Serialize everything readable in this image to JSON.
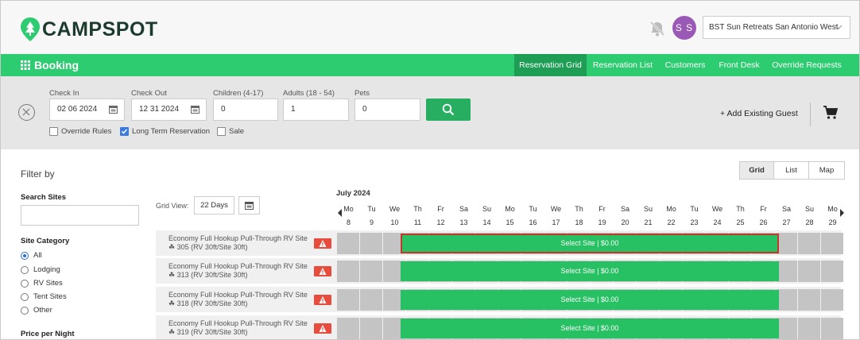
{
  "header": {
    "logo_text": "CAMPSPOT",
    "avatar_initials": "S S",
    "park_name": "BST Sun Retreats San Antonio West",
    "colors": {
      "brand": "#2ecc71",
      "avatar": "#9b59b6"
    }
  },
  "nav": {
    "title": "Booking",
    "tabs": [
      {
        "label": "Reservation Grid",
        "active": true
      },
      {
        "label": "Reservation List",
        "active": false
      },
      {
        "label": "Customers",
        "active": false
      },
      {
        "label": "Front Desk",
        "active": false
      },
      {
        "label": "Override Requests",
        "active": false
      }
    ]
  },
  "search": {
    "check_in_label": "Check In",
    "check_in_value": "02 06 2024",
    "check_out_label": "Check Out",
    "check_out_value": "12 31 2024",
    "children_label": "Children (4-17)",
    "children_value": "0",
    "adults_label": "Adults (18 - 54)",
    "adults_value": "1",
    "pets_label": "Pets",
    "pets_value": "0",
    "checkboxes": [
      {
        "label": "Override Rules",
        "checked": false
      },
      {
        "label": "Long Term Reservation",
        "checked": true
      },
      {
        "label": "Sale",
        "checked": false
      }
    ],
    "add_guest_label": "+ Add Existing Guest"
  },
  "filter": {
    "title": "Filter by",
    "search_sites_label": "Search Sites",
    "site_category_label": "Site Category",
    "categories": [
      {
        "label": "All",
        "selected": true
      },
      {
        "label": "Lodging",
        "selected": false
      },
      {
        "label": "RV Sites",
        "selected": false
      },
      {
        "label": "Tent Sites",
        "selected": false
      },
      {
        "label": "Other",
        "selected": false
      }
    ],
    "price_label": "Price per Night"
  },
  "view_toggle": [
    "Grid",
    "List",
    "Map"
  ],
  "grid": {
    "view_label": "Grid View:",
    "days_label": "22 Days",
    "month": "July 2024",
    "days": [
      {
        "name": "Mo",
        "num": "8"
      },
      {
        "name": "Tu",
        "num": "9"
      },
      {
        "name": "We",
        "num": "10"
      },
      {
        "name": "Th",
        "num": "11"
      },
      {
        "name": "Fr",
        "num": "12"
      },
      {
        "name": "Sa",
        "num": "13"
      },
      {
        "name": "Su",
        "num": "14"
      },
      {
        "name": "Mo",
        "num": "15"
      },
      {
        "name": "Tu",
        "num": "16"
      },
      {
        "name": "We",
        "num": "17"
      },
      {
        "name": "Th",
        "num": "18"
      },
      {
        "name": "Fr",
        "num": "19"
      },
      {
        "name": "Sa",
        "num": "20"
      },
      {
        "name": "Su",
        "num": "21"
      },
      {
        "name": "Mo",
        "num": "22"
      },
      {
        "name": "Tu",
        "num": "23"
      },
      {
        "name": "We",
        "num": "24"
      },
      {
        "name": "Th",
        "num": "25"
      },
      {
        "name": "Fr",
        "num": "26"
      },
      {
        "name": "Sa",
        "num": "27"
      },
      {
        "name": "Su",
        "num": "28"
      },
      {
        "name": "Mo",
        "num": "29"
      }
    ],
    "rows": [
      {
        "site_type": "Economy Full Hookup Pull-Through RV Site",
        "site_info": "305 (RV 30ft/Site 30ft)",
        "bar_label": "Select Site | $0.00",
        "selected": true
      },
      {
        "site_type": "Economy Full Hookup Pull-Through RV Site",
        "site_info": "313 (RV 30ft/Site 30ft)",
        "bar_label": "Select Site | $0.00",
        "selected": false
      },
      {
        "site_type": "Economy Full Hookup Pull-Through RV Site",
        "site_info": "318 (RV 30ft/Site 30ft)",
        "bar_label": "Select Site | $0.00",
        "selected": false
      },
      {
        "site_type": "Economy Full Hookup Pull-Through RV Site",
        "site_info": "319 (RV 30ft/Site 30ft)",
        "bar_label": "Select Site | $0.00",
        "selected": false
      }
    ]
  }
}
